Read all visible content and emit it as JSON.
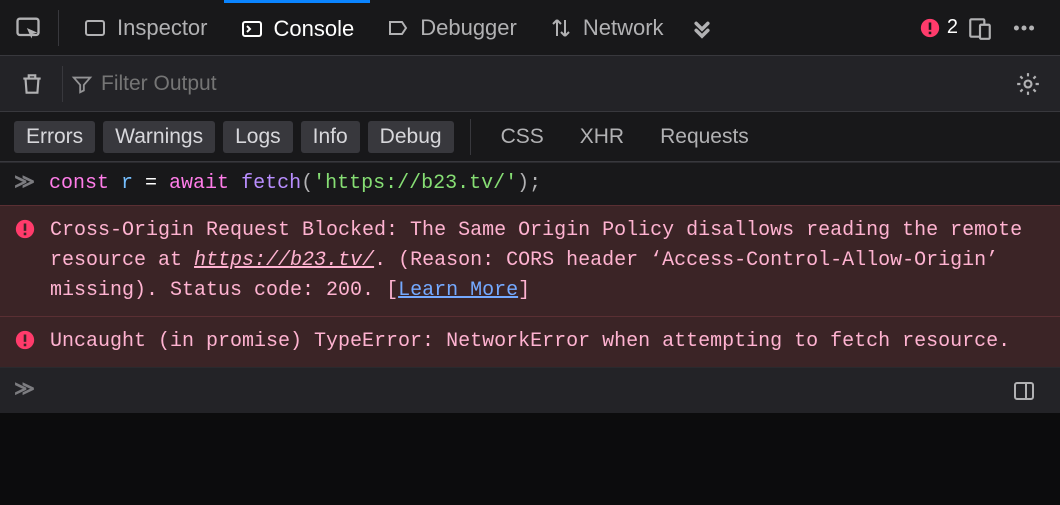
{
  "tabs": {
    "inspector": "Inspector",
    "console": "Console",
    "debugger": "Debugger",
    "network": "Network"
  },
  "errorCount": "2",
  "filter": {
    "placeholder": "Filter Output"
  },
  "categories": {
    "errors": "Errors",
    "warnings": "Warnings",
    "logs": "Logs",
    "info": "Info",
    "debug": "Debug",
    "css": "CSS",
    "xhr": "XHR",
    "requests": "Requests"
  },
  "input": {
    "kw1": "const",
    "var": "r",
    "eq": "=",
    "kw2": "await",
    "fn": "fetch",
    "po": "(",
    "str": "'https://b23.tv/'",
    "pc": ")",
    "semi": ";"
  },
  "err1": {
    "pre": "Cross-Origin Request Blocked: The Same Origin Policy disallows reading the remote resource at ",
    "url": "https://b23.tv/",
    "mid": ". (Reason: CORS header ‘Access-Control-Allow-Origin’ missing). Status code: 200. ",
    "lb": "[",
    "learn": "Learn More",
    "rb": "]"
  },
  "err2": {
    "text": "Uncaught (in promise) TypeError: NetworkError when attempting to fetch resource."
  }
}
